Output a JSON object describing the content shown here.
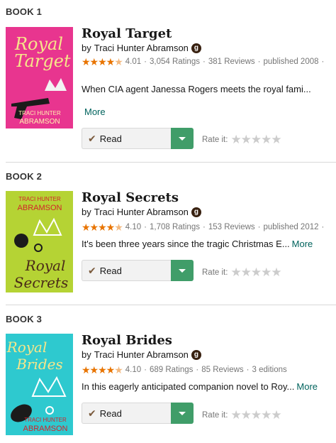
{
  "books": [
    {
      "number_label": "BOOK 1",
      "title": "Royal Target",
      "by_label": "by",
      "author": "Traci Hunter Abramson",
      "author_badge": "g",
      "rating": 4.01,
      "avg_rating": "4.01",
      "ratings": "3,054 Ratings",
      "reviews": "381 Reviews",
      "published": "published 2008",
      "trailing_sep": "·",
      "description": "When CIA agent Janessa Rogers meets the royal fami...",
      "more_label": "More",
      "shelf_label": "Read",
      "rate_label": "Rate it:",
      "cover_color": "#e8358f",
      "cover_title_lines": [
        "Royal",
        "Target"
      ],
      "cover_author_lines": [
        "TRACI HUNTER",
        "ABRAMSON"
      ]
    },
    {
      "number_label": "BOOK 2",
      "title": "Royal Secrets",
      "by_label": "by",
      "author": "Traci Hunter Abramson",
      "author_badge": "g",
      "rating": 4.1,
      "avg_rating": "4.10",
      "ratings": "1,708 Ratings",
      "reviews": "153 Reviews",
      "published": "published 2012",
      "trailing_sep": "·",
      "description": "It's been three years since the tragic Christmas E...",
      "more_label": "More",
      "shelf_label": "Read",
      "rate_label": "Rate it:",
      "cover_color": "#b5d334",
      "cover_title_lines": [
        "Royal",
        "Secrets"
      ],
      "cover_author_lines": [
        "TRACI HUNTER",
        "ABRAMSON"
      ]
    },
    {
      "number_label": "BOOK 3",
      "title": "Royal Brides",
      "by_label": "by",
      "author": "Traci Hunter Abramson",
      "author_badge": "g",
      "rating": 4.1,
      "avg_rating": "4.10",
      "ratings": "689 Ratings",
      "reviews": "85 Reviews",
      "published": "3 editions",
      "trailing_sep": "",
      "description": "In this eagerly anticipated companion novel to Roy...",
      "more_label": "More",
      "shelf_label": "Read",
      "rate_label": "Rate it:",
      "cover_color": "#2ec9cf",
      "cover_title_lines": [
        "Royal",
        "Brides"
      ],
      "cover_author_lines": [
        "TRACI HUNTER",
        "ABRAMSON"
      ]
    }
  ],
  "meta_separator": "·",
  "colors": {
    "accent_green": "#409d69",
    "star_orange": "#e87400",
    "link": "#00635d"
  }
}
